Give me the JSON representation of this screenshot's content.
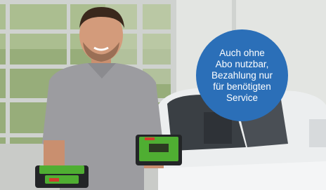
{
  "promo": {
    "text": "Auch ohne\nAbo nutzbar,\nBezahlung nur\nfür benötigten\nService",
    "color": "#2b6fb8"
  },
  "colors": {
    "device_green": "#4fae32",
    "device_body": "#232527",
    "shirt": "#9c9ca0",
    "car": "#eceeef",
    "foliage": "#97ad7a"
  },
  "photo": {
    "subject": "man-holding-two-diagnostic-devices",
    "background": "garage-window-and-white-car"
  }
}
